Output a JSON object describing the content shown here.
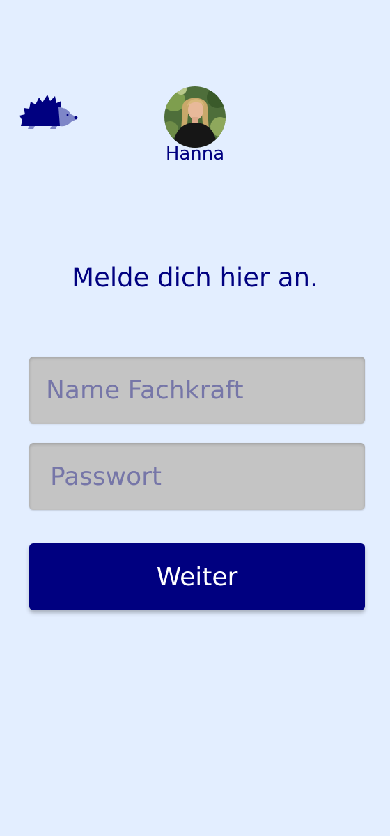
{
  "header": {
    "logo_icon": "hedgehog-icon",
    "user": {
      "name": "Hanna",
      "avatar_icon": "user-avatar-photo"
    }
  },
  "login": {
    "heading": "Melde dich hier an.",
    "name_placeholder": "Name Fachkraft",
    "password_placeholder": "Passwort",
    "submit_label": "Weiter"
  },
  "colors": {
    "background": "#E3EEFF",
    "primary": "#000080",
    "input_background": "#C4C4C4",
    "placeholder": "#7676A8",
    "button_text": "#FFFFFF"
  }
}
